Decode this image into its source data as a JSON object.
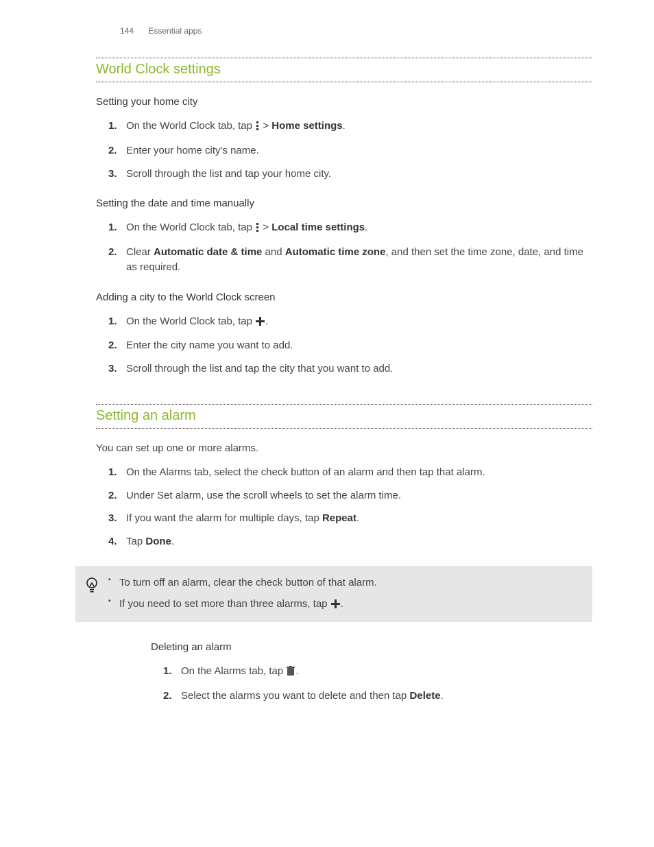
{
  "header": {
    "page_number": "144",
    "section": "Essential apps"
  },
  "s1": {
    "title": "World Clock settings",
    "sub1": {
      "title": "Setting your home city",
      "step1_a": "On the World Clock tab, tap ",
      "step1_b": " > ",
      "step1_c": "Home settings",
      "step1_d": ".",
      "step2": "Enter your home city's name.",
      "step3": "Scroll through the list and tap your home city."
    },
    "sub2": {
      "title": "Setting the date and time manually",
      "step1_a": "On the World Clock tab, tap ",
      "step1_b": " > ",
      "step1_c": "Local time settings",
      "step1_d": ".",
      "step2_a": "Clear ",
      "step2_b": "Automatic date & time",
      "step2_c": " and ",
      "step2_d": "Automatic time zone",
      "step2_e": ", and then set the time zone, date, and time as required."
    },
    "sub3": {
      "title": "Adding a city to the World Clock screen",
      "step1_a": "On the World Clock tab, tap ",
      "step1_b": ".",
      "step2": "Enter the city name you want to add.",
      "step3": "Scroll through the list and tap the city that you want to add."
    }
  },
  "s2": {
    "title": "Setting an alarm",
    "lead": "You can set up one or more alarms.",
    "step1": "On the Alarms tab, select the check button of an alarm and then tap that alarm.",
    "step2": "Under Set alarm, use the scroll wheels to set the alarm time.",
    "step3_a": "If you want the alarm for multiple days, tap ",
    "step3_b": "Repeat",
    "step3_c": ".",
    "step4_a": "Tap ",
    "step4_b": "Done",
    "step4_c": ".",
    "tip1": "To turn off an alarm, clear the check button of that alarm.",
    "tip2_a": "If you need to set more than three alarms, tap ",
    "tip2_b": ".",
    "sub1": {
      "title": "Deleting an alarm",
      "step1_a": "On the Alarms tab, tap ",
      "step1_b": ".",
      "step2_a": "Select the alarms you want to delete and then tap ",
      "step2_b": "Delete",
      "step2_c": "."
    }
  }
}
